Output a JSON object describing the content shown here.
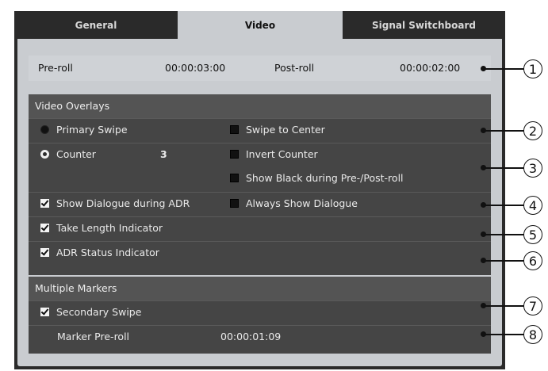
{
  "tabs": {
    "general": "General",
    "video": "Video",
    "signal": "Signal Switchboard"
  },
  "preroll": {
    "pre_label": "Pre-roll",
    "pre_value": "00:00:03:00",
    "post_label": "Post-roll",
    "post_value": "00:00:02:00"
  },
  "overlays": {
    "header": "Video Overlays",
    "primary_swipe": "Primary Swipe",
    "swipe_to_center": "Swipe to Center",
    "counter": "Counter",
    "counter_value": "3",
    "invert_counter": "Invert Counter",
    "show_black": "Show Black during Pre-/Post-roll",
    "show_dialogue_adr": "Show Dialogue during ADR",
    "always_show_dialogue": "Always Show Dialogue",
    "take_length": "Take Length Indicator",
    "adr_status": "ADR Status Indicator"
  },
  "markers": {
    "header": "Multiple Markers",
    "secondary_swipe": "Secondary Swipe",
    "marker_preroll_label": "Marker Pre-roll",
    "marker_preroll_value": "00:00:01:09"
  },
  "callouts": [
    "1",
    "2",
    "3",
    "4",
    "5",
    "6",
    "7",
    "8"
  ],
  "colors": {
    "dark_bg": "#2a2a2a",
    "panel": "#c9ccd0",
    "section": "#454545",
    "header": "#545454"
  }
}
